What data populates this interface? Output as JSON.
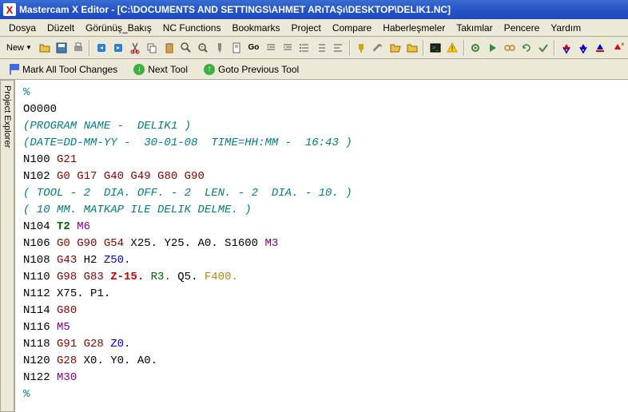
{
  "title": "Mastercam X Editor - [C:\\DOCUMENTS AND SETTINGS\\AHMET ARıTAŞı\\DESKTOP\\DELIK1.NC]",
  "menu": {
    "file": "Dosya",
    "edit": "Düzelt",
    "view": "Görünüş_Bakış",
    "nc": "NC Functions",
    "bookmarks": "Bookmarks",
    "project": "Project",
    "compare": "Compare",
    "comm": "Haberleşmeler",
    "tools": "Takımlar",
    "window": "Pencere",
    "help": "Yardım"
  },
  "toolbar": {
    "new": "New"
  },
  "toolbar2": {
    "markall": "Mark All Tool Changes",
    "next": "Next Tool",
    "prev": "Goto Previous Tool"
  },
  "sidebar": {
    "project": "Project Explorer"
  },
  "code": {
    "l0": "%",
    "l1": "O0000",
    "l2": "(PROGRAM NAME -  DELIK1 )",
    "l3": "(DATE=DD-MM-YY -  30-01-08  TIME=HH:MM -  16:43 )",
    "l4_n": "N100 ",
    "l4_g": "G21",
    "l5_n": "N102 ",
    "l5_g": "G0 G17 G40 G49 G80 G90",
    "l6": "( TOOL - 2  DIA. OFF. - 2  LEN. - 2  DIA. - 10. )",
    "l7": "( 10 MM. MATKAP ILE DELIK DELME. )",
    "l8_n": "N104 ",
    "l8_t": "T2",
    "l8_m": " M6",
    "l9_n": "N106 ",
    "l9_g": "G0 G90 G54",
    "l9_xy": " X25. Y25.",
    "l9_a": " A0.",
    "l9_s": " S1600",
    "l9_m": " M3",
    "l10_n": "N108 ",
    "l10_g": "G43",
    "l10_h": " H2",
    "l10_z": " Z50.",
    "l11_n": "N110 ",
    "l11_g": "G98 G83",
    "l11_z": " Z-15.",
    "l11_r": " R3.",
    "l11_q": " Q5.",
    "l11_f": " F400.",
    "l12_n": "N112 ",
    "l12_xy": "X75.",
    "l12_p": " P1.",
    "l13_n": "N114 ",
    "l13_g": "G80",
    "l14_n": "N116 ",
    "l14_m": "M5",
    "l15_n": "N118 ",
    "l15_g": "G91 G28",
    "l15_z": " Z0.",
    "l16_n": "N120 ",
    "l16_g": "G28",
    "l16_xy": " X0. Y0.",
    "l16_a": " A0.",
    "l17_n": "N122 ",
    "l17_m": "M30",
    "l18": "%"
  }
}
